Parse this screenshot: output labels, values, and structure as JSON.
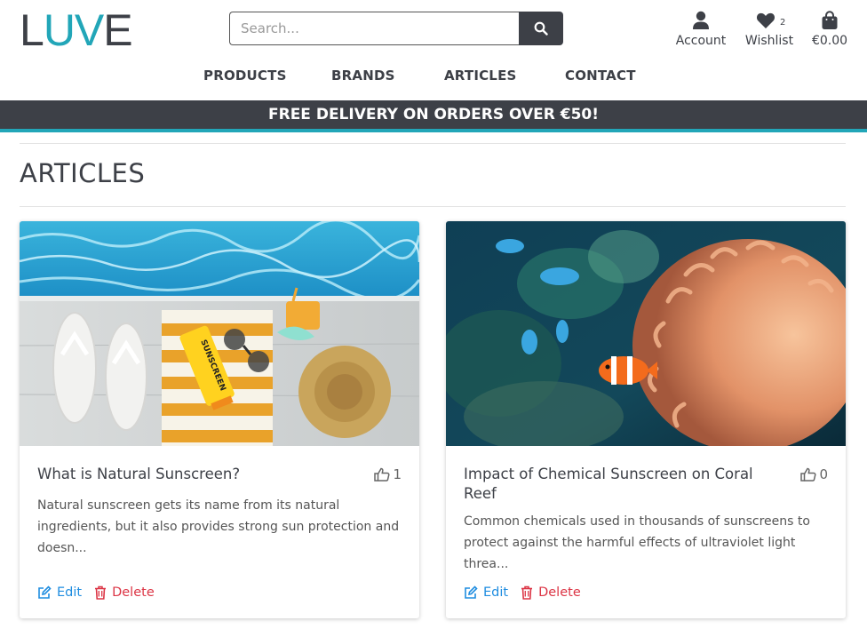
{
  "brand": {
    "logo_l": "L",
    "logo_uv": "UV",
    "logo_e": "E"
  },
  "search": {
    "placeholder": "Search..."
  },
  "header_icons": {
    "account_label": "Account",
    "wishlist_label": "Wishlist",
    "wishlist_count": "2",
    "bag_label": "€0.00"
  },
  "nav": [
    "PRODUCTS",
    "BRANDS",
    "ARTICLES",
    "CONTACT"
  ],
  "banner": "FREE DELIVERY ON ORDERS OVER €50!",
  "page_title": "ARTICLES",
  "articles": [
    {
      "title": "What is Natural Sunscreen?",
      "likes": "1",
      "excerpt": "Natural sunscreen gets its name from its natural ingredients, but it also provides strong sun protection and doesn...",
      "edit_label": "Edit",
      "delete_label": "Delete",
      "image": "beach-items-sunscreen-photo"
    },
    {
      "title": "Impact of Chemical Sunscreen on Coral Reef",
      "likes": "0",
      "excerpt": "Common chemicals used in thousands of sunscreens to protect against the harmful effects of ultraviolet light threa...",
      "edit_label": "Edit",
      "delete_label": "Delete",
      "image": "coral-reef-clownfish-photo"
    }
  ],
  "colors": {
    "brand_dark": "#3d4047",
    "brand_teal": "#22a6b8",
    "edit_blue": "#1f8de0",
    "delete_red": "#dc3545"
  }
}
